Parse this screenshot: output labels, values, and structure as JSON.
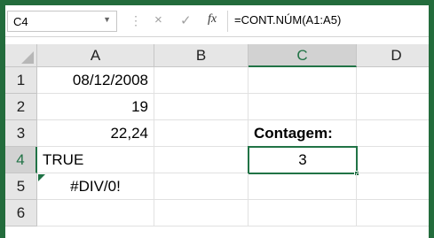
{
  "formula_bar": {
    "name_box": "C4",
    "separator": "⋮",
    "cancel_glyph": "×",
    "enter_glyph": "✓",
    "fx_label": "fx",
    "formula": "=CONT.NÚM(A1:A5)"
  },
  "columns": [
    "A",
    "B",
    "C",
    "D"
  ],
  "rows": [
    "1",
    "2",
    "3",
    "4",
    "5",
    "6"
  ],
  "cells": {
    "A1": "08/12/2008",
    "A2": "19",
    "A3": "22,24",
    "A4": "TRUE",
    "A5": "#DIV/0!",
    "C3": "Contagem:",
    "C4": "3"
  },
  "selected_cell": "C4",
  "colors": {
    "accent": "#217346",
    "frame": "#236c3c"
  }
}
